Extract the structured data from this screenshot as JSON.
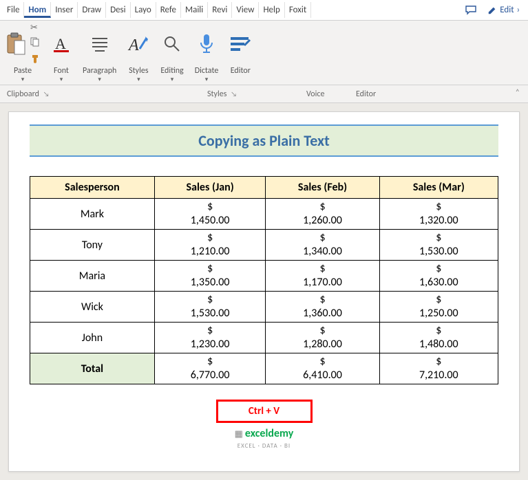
{
  "menubar": {
    "tabs": [
      "File",
      "Hom",
      "Inser",
      "Draw",
      "Desi",
      "Layo",
      "Refe",
      "Maili",
      "Revi",
      "View",
      "Help",
      "Foxit"
    ],
    "active_index": 1,
    "edit_label": "Edit"
  },
  "ribbon": {
    "paste_label": "Paste",
    "font_label": "Font",
    "paragraph_label": "Paragraph",
    "styles_label": "Styles",
    "editing_label": "Editing",
    "dictate_label": "Dictate",
    "editor_label": "Editor"
  },
  "group_labels": {
    "clipboard": "Clipboard",
    "styles": "Styles",
    "voice": "Voice",
    "editor": "Editor"
  },
  "doc": {
    "title": "Copying as Plain Text",
    "shortcut": "Ctrl + V",
    "watermark_brand": "exceldemy",
    "watermark_sub": "EXCEL · DATA · BI"
  },
  "table": {
    "headers": [
      "Salesperson",
      "Sales (Jan)",
      "Sales (Feb)",
      "Sales (Mar)"
    ],
    "rows": [
      {
        "name": "Mark",
        "vals": [
          "$ 1,450.00",
          "$ 1,260.00",
          "$ 1,320.00"
        ]
      },
      {
        "name": "Tony",
        "vals": [
          "$ 1,210.00",
          "$ 1,340.00",
          "$ 1,530.00"
        ]
      },
      {
        "name": "Maria",
        "vals": [
          "$ 1,350.00",
          "$ 1,170.00",
          "$ 1,630.00"
        ]
      },
      {
        "name": "Wick",
        "vals": [
          "$ 1,530.00",
          "$ 1,360.00",
          "$ 1,250.00"
        ]
      },
      {
        "name": "John",
        "vals": [
          "$ 1,230.00",
          "$ 1,280.00",
          "$ 1,480.00"
        ]
      }
    ],
    "total_label": "Total",
    "total_vals": [
      "$ 6,770.00",
      "$ 6,410.00",
      "$ 7,210.00"
    ]
  }
}
